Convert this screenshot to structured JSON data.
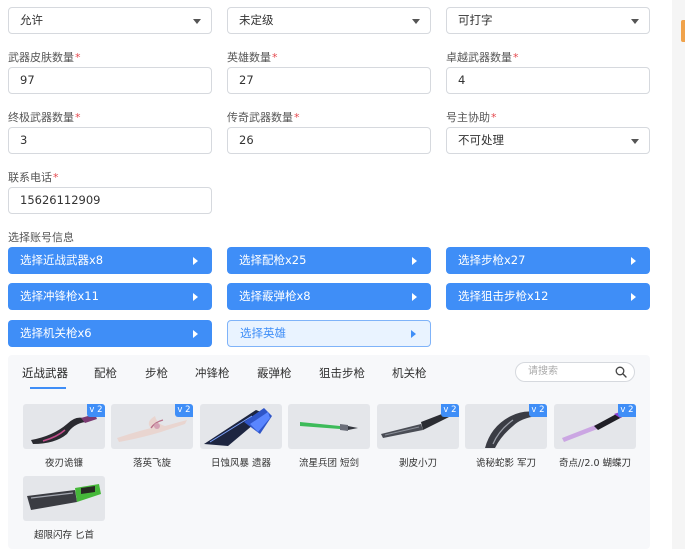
{
  "top_selects": [
    {
      "value": "允许"
    },
    {
      "value": "未定级"
    },
    {
      "value": "可打字"
    }
  ],
  "fields": [
    {
      "label": "武器皮肤数量",
      "value": "97",
      "required": "*"
    },
    {
      "label": "英雄数量",
      "value": "27",
      "required": "*"
    },
    {
      "label": "卓越武器数量",
      "value": "4",
      "required": "*"
    },
    {
      "label": "终极武器数量",
      "value": "3",
      "required": "*"
    },
    {
      "label": "传奇武器数量",
      "value": "26",
      "required": "*"
    },
    {
      "label": "号主协助",
      "value": "不可处理",
      "required": "*"
    },
    {
      "label": "联系电话",
      "value": "15626112909",
      "required": "*"
    }
  ],
  "account_section_label": "选择账号信息",
  "select_buttons": [
    {
      "label": "选择近战武器x8"
    },
    {
      "label": "选择配枪x25"
    },
    {
      "label": "选择步枪x27"
    },
    {
      "label": "选择冲锋枪x11"
    },
    {
      "label": "选择霰弹枪x8"
    },
    {
      "label": "选择狙击步枪x12"
    },
    {
      "label": "选择机关枪x6"
    },
    {
      "label": "选择英雄"
    }
  ],
  "tabs": [
    {
      "label": "近战武器"
    },
    {
      "label": "配枪"
    },
    {
      "label": "步枪"
    },
    {
      "label": "冲锋枪"
    },
    {
      "label": "霰弹枪"
    },
    {
      "label": "狙击步枪"
    },
    {
      "label": "机关枪"
    }
  ],
  "search": {
    "placeholder": "请搜索"
  },
  "items": [
    {
      "name": "夜刃诡镰",
      "badge": "v 2"
    },
    {
      "name": "落英飞旋",
      "badge": "v 2"
    },
    {
      "name": "日蚀风暴 遗器",
      "badge": ""
    },
    {
      "name": "流星兵团 短剑",
      "badge": ""
    },
    {
      "name": "剥皮小刀",
      "badge": "v 2"
    },
    {
      "name": "诡秘蛇影 军刀",
      "badge": "v 2"
    },
    {
      "name": "奇点//2.0 蝴蝶刀",
      "badge": "v 2"
    },
    {
      "name": "超限闪存 匕首",
      "badge": ""
    }
  ],
  "colors": {
    "accent": "#3f8ef7",
    "required": "#e5484d",
    "panel_bg": "#f7f8fa",
    "side_accent": "#f0a24a"
  }
}
